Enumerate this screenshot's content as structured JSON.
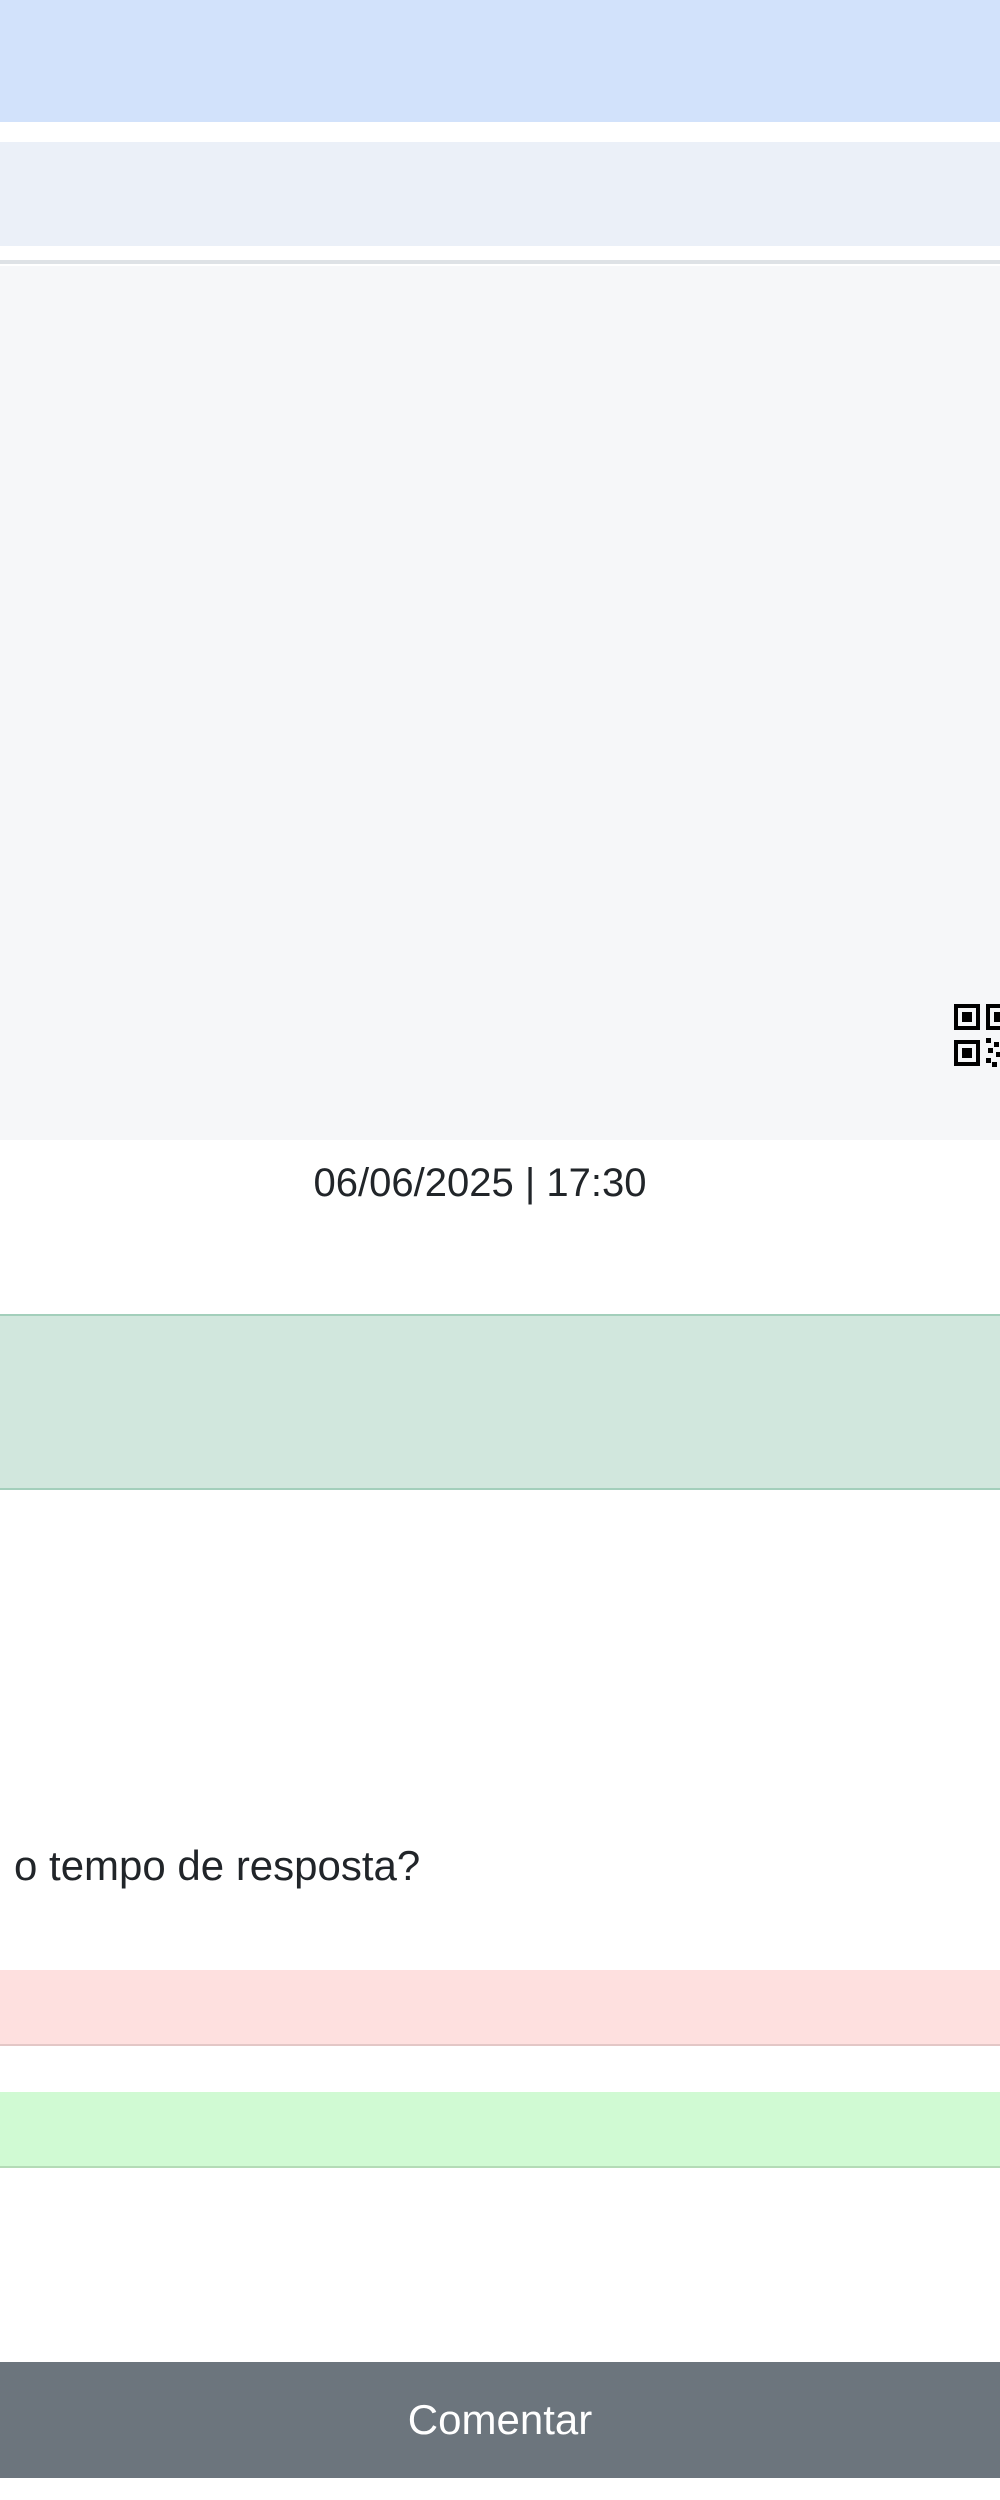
{
  "header": {},
  "media": {
    "qr_icon": "qr-code-icon"
  },
  "post": {
    "datetime": "06/06/2025 | 17:30"
  },
  "poll": {
    "question": "o tempo de resposta?",
    "options": [
      {
        "color": "#fee0df"
      },
      {
        "color": "#d0fad3"
      }
    ]
  },
  "actions": {
    "comment_label": "Comentar"
  },
  "colors": {
    "top_banner": "#d2e2fb",
    "sub_banner": "#ebf0f8",
    "success_alert": "#d1e7dd",
    "button": "#6c757d"
  }
}
